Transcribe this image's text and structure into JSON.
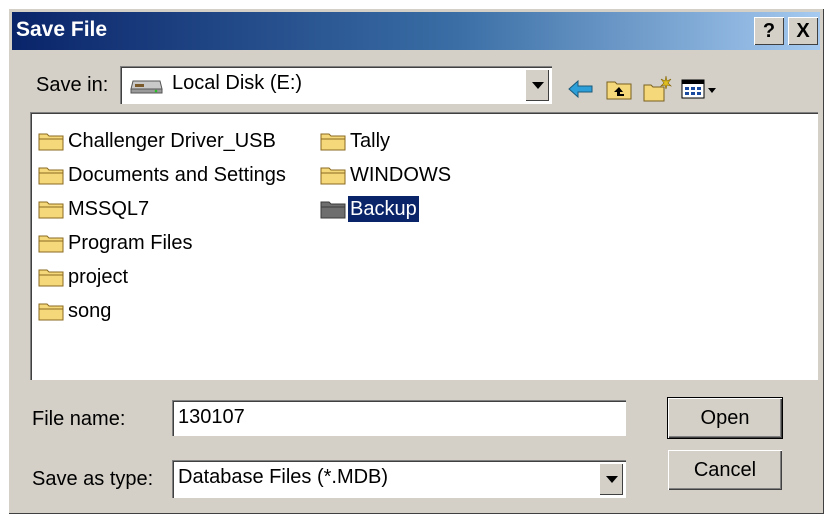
{
  "titlebar": {
    "title": "Save File",
    "help_label": "?",
    "close_label": "X"
  },
  "save_in": {
    "label": "Save in:",
    "value": "Local Disk (E:)"
  },
  "toolbar": {
    "icons": [
      "back-arrow-icon",
      "up-folder-icon",
      "new-folder-icon",
      "view-menu-icon"
    ]
  },
  "files": [
    {
      "name": "Challenger Driver_USB",
      "selected": false
    },
    {
      "name": "Documents and Settings",
      "selected": false
    },
    {
      "name": "MSSQL7",
      "selected": false
    },
    {
      "name": "Program Files",
      "selected": false
    },
    {
      "name": "project",
      "selected": false
    },
    {
      "name": "song",
      "selected": false
    },
    {
      "name": "Tally",
      "selected": false
    },
    {
      "name": "WINDOWS",
      "selected": false
    },
    {
      "name": "Backup",
      "selected": true
    }
  ],
  "file_name": {
    "label": "File name:",
    "value": "130107"
  },
  "save_as_type": {
    "label": "Save as type:",
    "value": "Database Files (*.MDB)"
  },
  "buttons": {
    "open": "Open",
    "cancel": "Cancel"
  },
  "colors": {
    "title_gradient_start": "#0a246a",
    "title_gradient_end": "#a6caf0",
    "selection": "#0a246a",
    "face": "#d4d0c8",
    "folder": "#f5d87a"
  }
}
